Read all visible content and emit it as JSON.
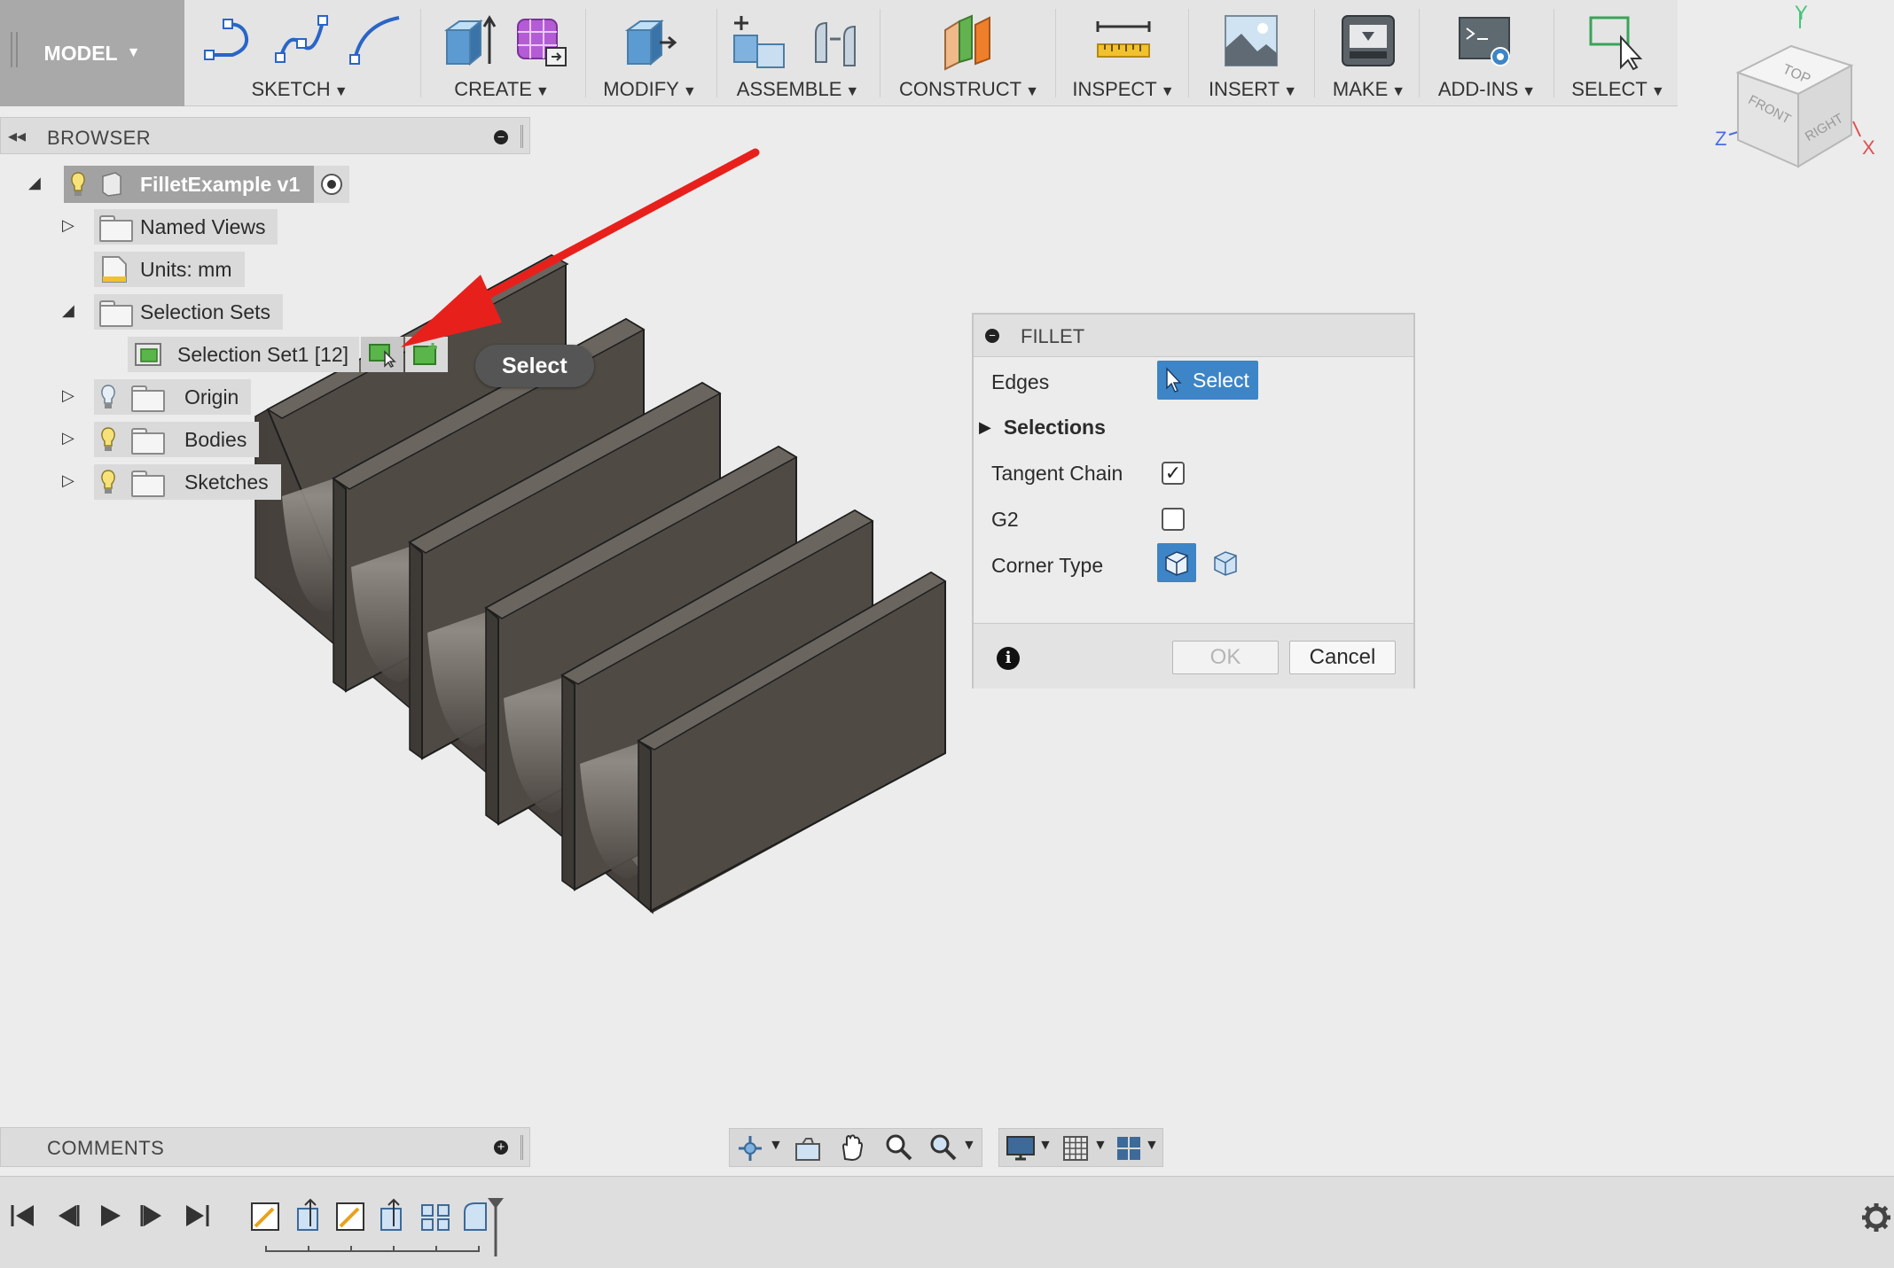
{
  "toolbar": {
    "workspace_label": "MODEL",
    "groups": [
      {
        "label": "SKETCH"
      },
      {
        "label": "CREATE"
      },
      {
        "label": "MODIFY"
      },
      {
        "label": "ASSEMBLE"
      },
      {
        "label": "CONSTRUCT"
      },
      {
        "label": "INSPECT"
      },
      {
        "label": "INSERT"
      },
      {
        "label": "MAKE"
      },
      {
        "label": "ADD-INS"
      },
      {
        "label": "SELECT"
      }
    ]
  },
  "viewcube": {
    "faces": {
      "top": "TOP",
      "front": "FRONT",
      "right": "RIGHT"
    },
    "axes": {
      "x": "X",
      "y": "Y",
      "z": "Z"
    },
    "axis_colors": {
      "x": "#e05050",
      "y": "#47c47a",
      "z": "#4a6de0"
    }
  },
  "browser": {
    "title": "BROWSER",
    "root": {
      "label": "FilletExample v1"
    },
    "items": [
      {
        "label": "Named Views"
      },
      {
        "label": "Units: mm"
      },
      {
        "label": "Selection Sets"
      },
      {
        "label": "Selection Set1 [12]"
      },
      {
        "label": "Origin"
      },
      {
        "label": "Bodies"
      },
      {
        "label": "Sketches"
      }
    ]
  },
  "tooltip": {
    "text": "Select"
  },
  "fillet": {
    "title": "FILLET",
    "edges_label": "Edges",
    "edges_button": "Select",
    "selections_label": "Selections",
    "tangent_chain_label": "Tangent Chain",
    "tangent_chain_checked": true,
    "g2_label": "G2",
    "g2_checked": false,
    "corner_type_label": "Corner Type",
    "ok_label": "OK",
    "cancel_label": "Cancel"
  },
  "comments": {
    "title": "COMMENTS"
  },
  "colors": {
    "accent": "#3d85c6",
    "annotation_arrow": "#e8201c",
    "model_face": "#4f4a44"
  }
}
